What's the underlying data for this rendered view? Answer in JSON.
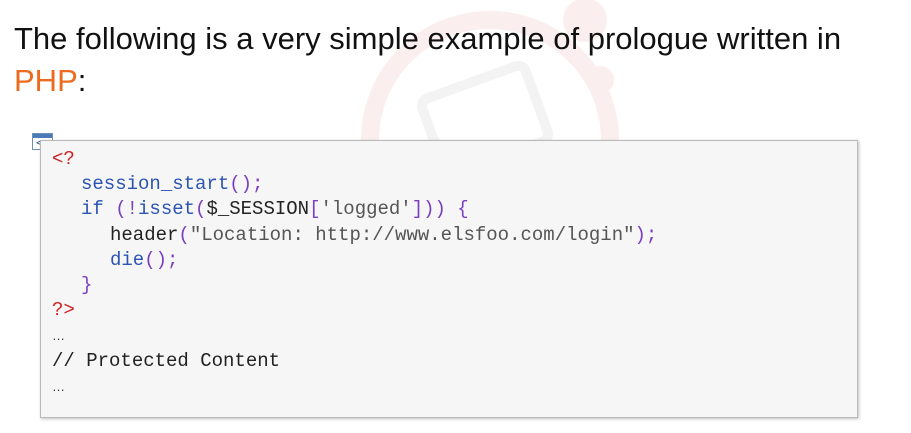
{
  "heading": {
    "line1": "The following is a very simple example of prologue written in",
    "accent": "PHP",
    "suffix": ":"
  },
  "code_icon": {
    "glyph": "</>"
  },
  "code": {
    "open_tag": "<?",
    "l2_fn": "session_start",
    "l2_punc": "();",
    "l3_kw": "if",
    "l3_p1": " (!",
    "l3_fn": "isset",
    "l3_p2": "(",
    "l3_var": "$_SESSION",
    "l3_p3": "[",
    "l3_str": "'logged'",
    "l3_p4": "])) {",
    "l4_fn": "header",
    "l4_p1": "(",
    "l4_str": "\"Location: http://www.elsfoo.com/login\"",
    "l4_p2": ");",
    "l5_fn": "die",
    "l5_punc": "();",
    "close_brace": "}",
    "close_tag": "?>",
    "ellipsis1": "…",
    "comment": "// Protected Content",
    "ellipsis2": "…"
  },
  "colors": {
    "accent": "#ec6b1f",
    "tag": "#cc1f1f",
    "function": "#2b54b3",
    "punctuation": "#7a3fbf"
  }
}
